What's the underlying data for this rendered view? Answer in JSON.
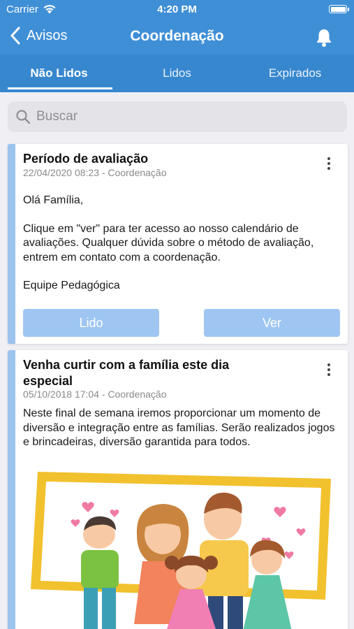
{
  "status_bar": {
    "carrier": "Carrier",
    "time": "4:20 PM"
  },
  "nav": {
    "back_label": "Avisos",
    "title": "Coordenação"
  },
  "tabs": [
    {
      "label": "Não Lidos",
      "active": true
    },
    {
      "label": "Lidos",
      "active": false
    },
    {
      "label": "Expirados",
      "active": false
    }
  ],
  "search": {
    "placeholder": "Buscar"
  },
  "notices": [
    {
      "title": "Período de avaliação",
      "meta": "22/04/2020 08:23 - Coordenação",
      "body": [
        "Olá Família,",
        "Clique em \"ver\" para ter acesso ao nosso calendário de avaliações. Qualquer dúvida sobre o método de avaliação, entrem em contato com a coordenação.",
        "Equipe Pedagógica"
      ],
      "buttons": {
        "read": "Lido",
        "view": "Ver"
      }
    },
    {
      "title": "Venha curtir com a família este dia especial",
      "meta": "05/10/2018 17:04 - Coordenação",
      "body": "Neste final de semana iremos proporcionar um momento de diversão e integração entre as famílias. Serão realizados jogos e brincadeiras, diversão garantida para todos.",
      "image": "family-illustration"
    }
  ],
  "colors": {
    "header": "#3f8fd6",
    "tab_bar": "#3787cf",
    "card_accent": "#9dc3ef",
    "button": "#9fc6f2",
    "frame": "#f2c12e"
  },
  "icons": [
    "wifi-icon",
    "battery-icon",
    "chevron-left-icon",
    "bell-icon",
    "search-icon",
    "more-vertical-icon"
  ]
}
